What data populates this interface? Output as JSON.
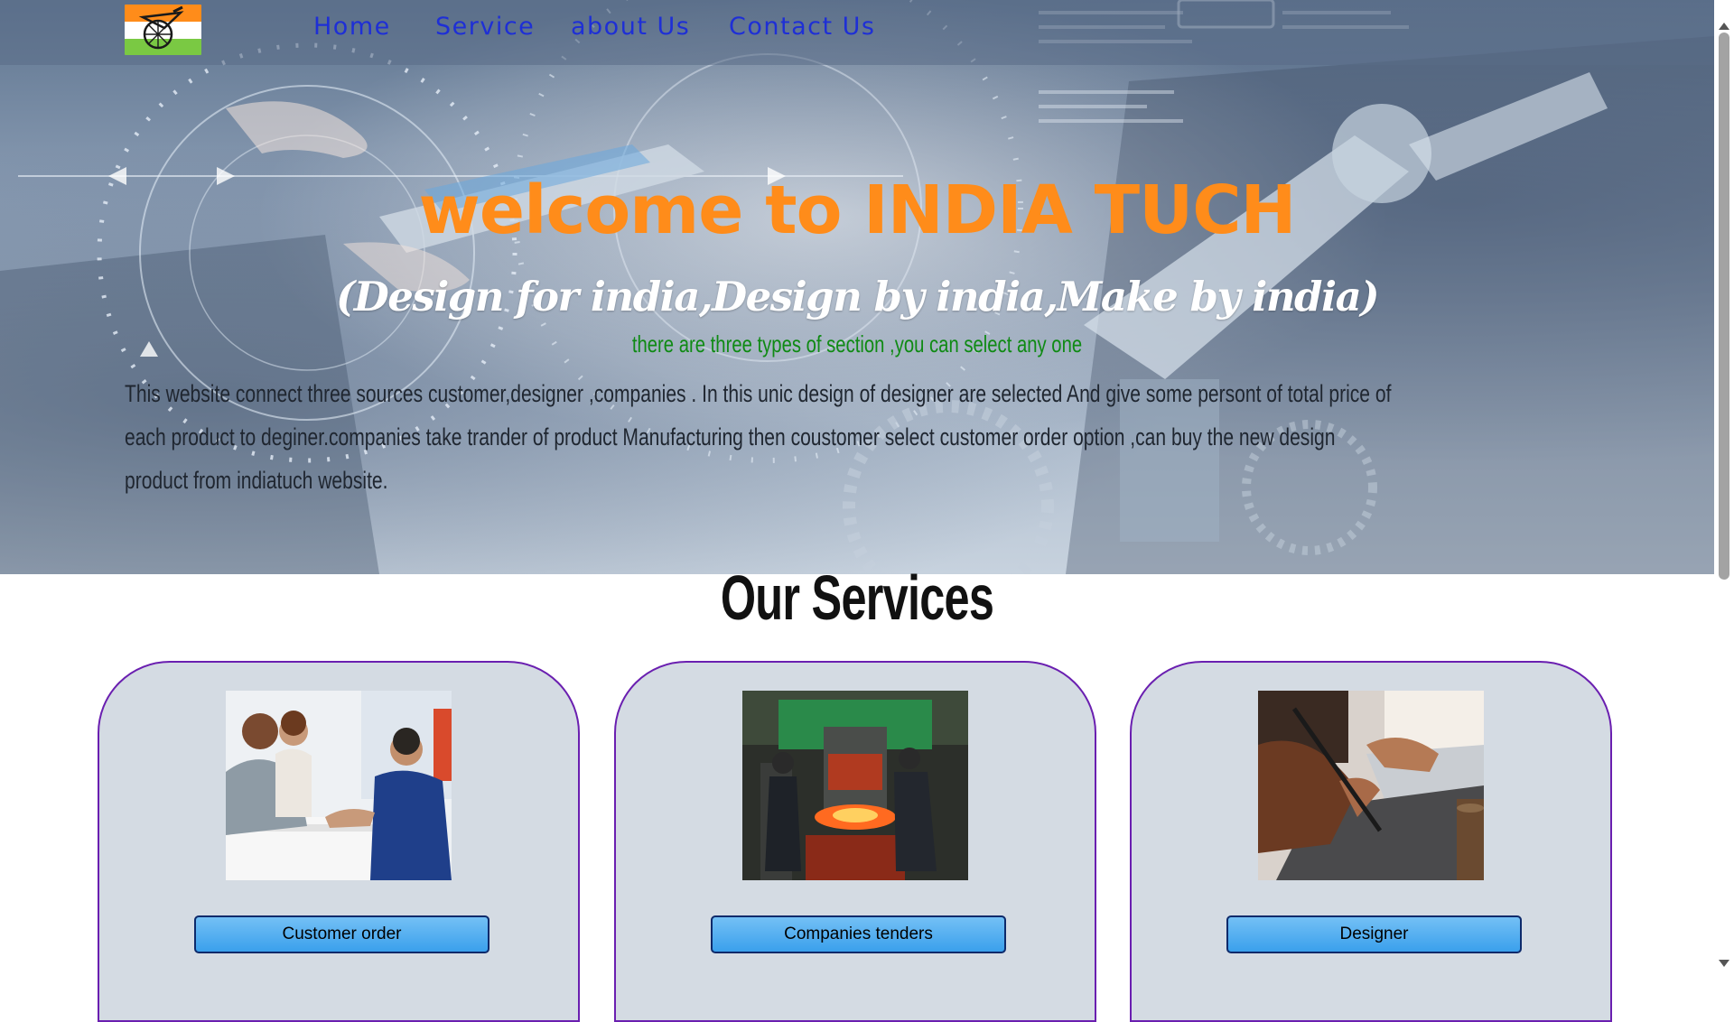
{
  "nav": {
    "links": [
      "Home",
      "Service",
      "about Us",
      "Contact Us"
    ]
  },
  "logo": {
    "icon": "chakra-wheel-icon",
    "colors": [
      "#ff8c1a",
      "#ffffff",
      "#7ac943"
    ]
  },
  "hero": {
    "title": "welcome to INDIA TUCH",
    "tagline": "(Design for india,Design by india,Make by india)",
    "section_note": "there are three types of section ,you can select any one",
    "description": "This website connect three sources customer,designer ,companies . In this unic design of designer are selected And give some persont of total price of each product to deginer.companies take trander of product Manufacturing then coustomer select customer order option ,can buy the new design product from indiatuch website."
  },
  "services": {
    "title": "Our Services",
    "cards": [
      {
        "image": "customer-handshake-photo",
        "button": "Customer order"
      },
      {
        "image": "factory-forge-photo",
        "button": "Companies tenders"
      },
      {
        "image": "designer-drawing-photo",
        "button": "Designer"
      }
    ]
  },
  "colors": {
    "title_orange": "#ff8c1a",
    "nav_blue": "#1e2fd6",
    "note_green": "#0f8a14",
    "card_border": "#6a1fb0",
    "card_bg": "#d4dbe3",
    "button_blue": "#3aa0ec"
  }
}
